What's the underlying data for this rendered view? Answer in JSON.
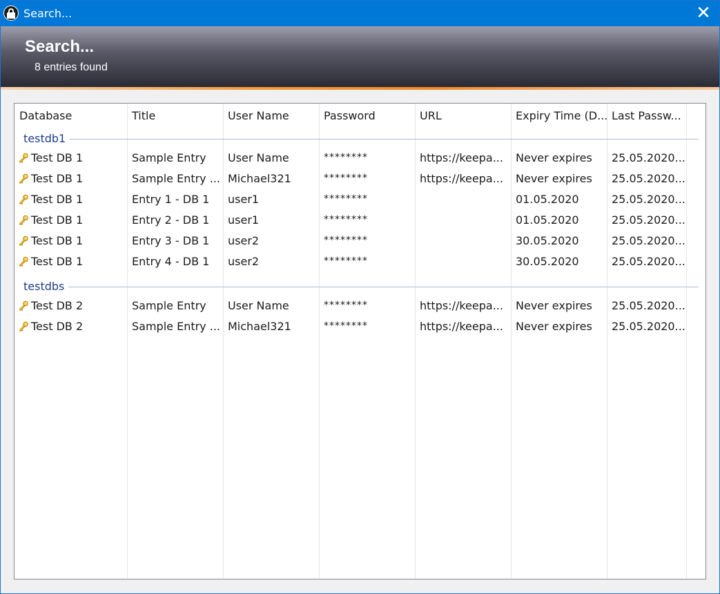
{
  "window": {
    "title": "Search..."
  },
  "banner": {
    "title": "Search...",
    "subtitle": "8 entries found"
  },
  "columns": [
    "Database",
    "Title",
    "User Name",
    "Password",
    "URL",
    "Expiry Time (D...",
    "Last Passw..."
  ],
  "groups": [
    {
      "name": "testdb1",
      "rows": [
        [
          "Test DB 1",
          "Sample Entry",
          "User Name",
          "********",
          "https://keepa...",
          "Never expires",
          "25.05.2020..."
        ],
        [
          "Test DB 1",
          "Sample Entry ...",
          "Michael321",
          "********",
          "https://keepa...",
          "Never expires",
          "25.05.2020..."
        ],
        [
          "Test DB 1",
          "Entry 1 - DB 1",
          "user1",
          "********",
          "",
          "01.05.2020",
          "25.05.2020..."
        ],
        [
          "Test DB 1",
          "Entry 2 - DB 1",
          "user1",
          "********",
          "",
          "01.05.2020",
          "25.05.2020..."
        ],
        [
          "Test DB 1",
          "Entry 3 - DB 1",
          "user2",
          "********",
          "",
          "30.05.2020",
          "25.05.2020..."
        ],
        [
          "Test DB 1",
          "Entry 4 - DB 1",
          "user2",
          "********",
          "",
          "30.05.2020",
          "25.05.2020..."
        ]
      ]
    },
    {
      "name": "testdbs",
      "rows": [
        [
          "Test DB 2",
          "Sample Entry",
          "User Name",
          "********",
          "https://keepa...",
          "Never expires",
          "25.05.2020..."
        ],
        [
          "Test DB 2",
          "Sample Entry ...",
          "Michael321",
          "********",
          "https://keepa...",
          "Never expires",
          "25.05.2020..."
        ]
      ]
    }
  ],
  "icons": {
    "entry_icon": "key-icon",
    "app_icon": "padlock-icon",
    "close_icon": "close-icon"
  },
  "colors": {
    "titlebar": "#0078d7",
    "group_text": "#1e3b8c",
    "accent": "#f08a28"
  }
}
